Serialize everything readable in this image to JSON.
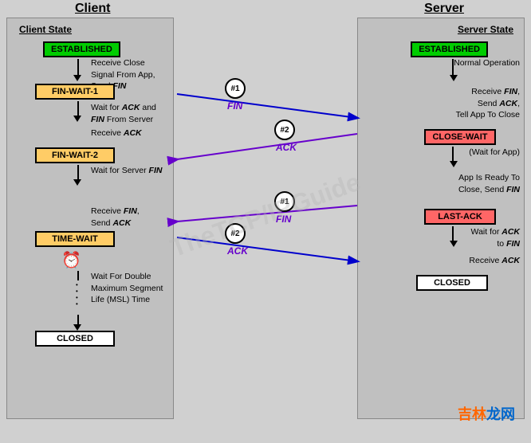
{
  "diagram": {
    "title_client": "Client",
    "title_server": "Server",
    "client_state_label": "Client State",
    "server_state_label": "Server State",
    "states": {
      "established": "ESTABLISHED",
      "fin_wait_1": "FIN-WAIT-1",
      "fin_wait_2": "FIN-WAIT-2",
      "time_wait": "TIME-WAIT",
      "closed_client": "CLOSED",
      "close_wait": "CLOSE-WAIT",
      "last_ack": "LAST-ACK",
      "closed_server": "CLOSED"
    },
    "descriptions": {
      "client_1": "Receive Close\nSignal From App,\nSend FIN",
      "client_2": "Wait for ACK and\nFIN From Server",
      "client_3": "Receive ACK",
      "client_4": "Wait for Server FIN",
      "client_5": "Receive FIN,\nSend ACK",
      "client_6": "Wait For Double\nMaximum Segment\nLife (MSL) Time",
      "server_1": "Normal Operation",
      "server_2": "Receive FIN,\nSend ACK,\nTell App To Close",
      "server_3": "Wait for App",
      "server_4": "App Is Ready To\nClose, Send FIN",
      "server_5": "Wait for ACK\nto FIN",
      "server_6": "Receive ACK"
    },
    "messages": {
      "fin1_label": "FIN",
      "fin1_number": "#1",
      "ack2_label": "ACK",
      "ack2_number": "#2",
      "fin3_label": "FIN",
      "fin3_number": "#1",
      "ack4_label": "ACK",
      "ack4_number": "#2"
    },
    "brand": {
      "orange": "吉林",
      "blue": "龙网"
    },
    "watermark": "TheTCP/IPGuide"
  }
}
